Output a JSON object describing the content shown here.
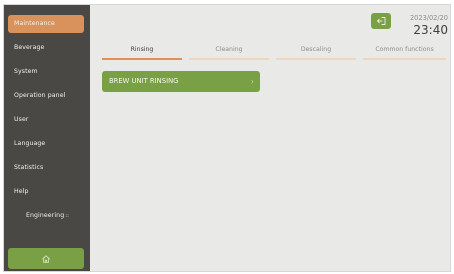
{
  "sidebar": {
    "items": [
      {
        "label": "Maintenance"
      },
      {
        "label": "Beverage"
      },
      {
        "label": "System"
      },
      {
        "label": "Operation panel"
      },
      {
        "label": "User"
      },
      {
        "label": "Language"
      },
      {
        "label": "Statistics"
      },
      {
        "label": "Help"
      },
      {
        "label": "Engineering",
        "arrow": "::"
      }
    ],
    "home_icon": "home-icon"
  },
  "header": {
    "date": "2023/02/20",
    "time": "23:40",
    "logout_icon": "logout-icon"
  },
  "tabs": [
    {
      "label": "Rinsing"
    },
    {
      "label": "Cleaning"
    },
    {
      "label": "Descaling"
    },
    {
      "label": "Common functions"
    }
  ],
  "main": {
    "rinse_button_label": "BREW UNIT RINSING",
    "rinse_button_chevron": "›"
  },
  "colors": {
    "accent_orange": "#d9925b",
    "accent_green": "#79a045",
    "sidebar": "#4a4845",
    "background": "#e9e9e7"
  }
}
